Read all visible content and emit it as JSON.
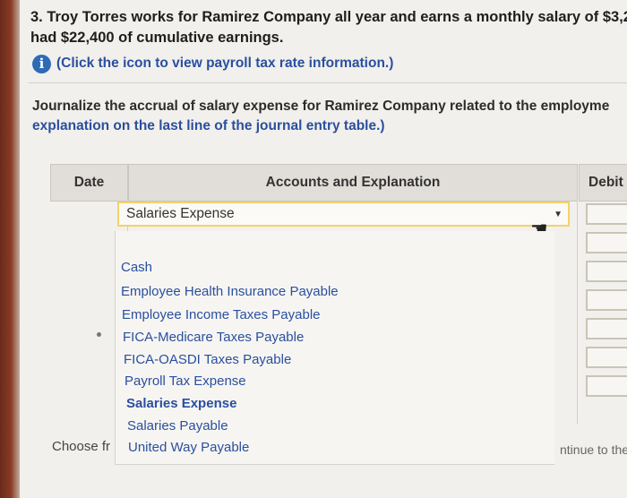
{
  "question": {
    "line1": "3. Troy Torres works for Ramirez Company all year and earns a monthly salary of $3,20",
    "line2": "had $22,400 of cumulative earnings."
  },
  "info_link": {
    "text": "(Click the icon to view payroll tax rate information.)"
  },
  "instructions": {
    "line1": "Journalize the accrual of salary expense for Ramirez Company related to the employme",
    "line2": "explanation on the last line of the journal entry table.)"
  },
  "table": {
    "headers": {
      "date": "Date",
      "accounts": "Accounts and Explanation",
      "debit": "Debit"
    },
    "selected_account": "Salaries Expense"
  },
  "dropdown": {
    "options": [
      "Cash",
      "Employee Health Insurance Payable",
      "Employee Income Taxes Payable",
      "FICA-Medicare Taxes Payable",
      "FICA-OASDI Taxes Payable",
      "Payroll Tax Expense",
      "Salaries Expense",
      "Salaries Payable",
      "United Way Payable"
    ],
    "highlighted": "Salaries Expense"
  },
  "footer": {
    "choose_text": "Choose fr",
    "continue_text": "ntinue to the r"
  },
  "colors": {
    "accent_blue": "#2a4fa0",
    "info_icon": "#2d6bb7",
    "select_border": "#f0d46a"
  }
}
